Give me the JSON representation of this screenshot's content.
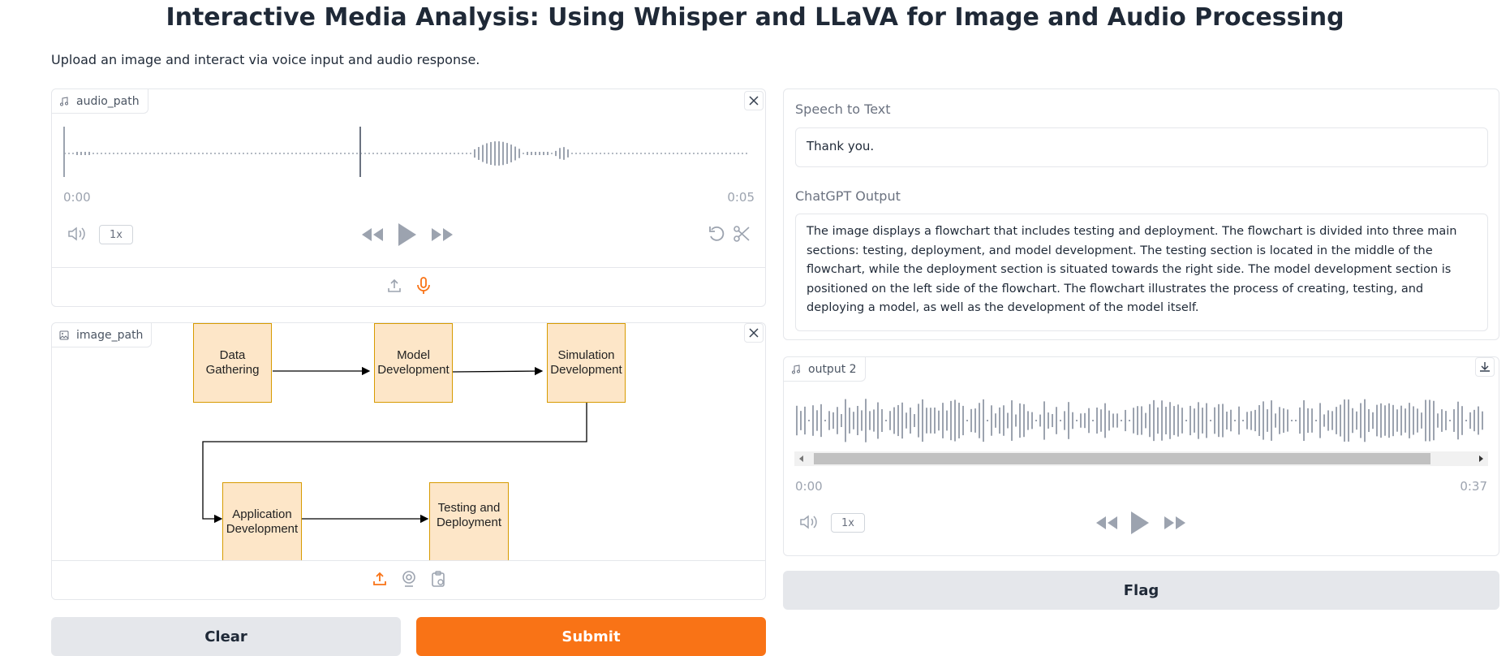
{
  "page": {
    "title": "Interactive Media Analysis: Using Whisper and LLaVA for Image and Audio Processing",
    "description": "Upload an image and interact via voice input and audio response."
  },
  "audio_input": {
    "label": "audio_path",
    "time_start": "0:00",
    "time_end": "0:05",
    "playback_rate": "1x"
  },
  "image_input": {
    "label": "image_path",
    "flowchart": {
      "boxes": [
        {
          "line1": "Data",
          "line2": "Gathering"
        },
        {
          "line1": "Model",
          "line2": "Development"
        },
        {
          "line1": "Simulation",
          "line2": "Development"
        },
        {
          "line1": "Application",
          "line2": "Development"
        },
        {
          "line1": "Testing and",
          "line2": "Deployment"
        }
      ]
    }
  },
  "speech_to_text": {
    "label": "Speech to Text",
    "value": "Thank you."
  },
  "chatgpt_output": {
    "label": "ChatGPT Output",
    "value": "The image displays a flowchart that includes testing and deployment. The flowchart is divided into three main sections: testing, deployment, and model development. The testing section is located in the middle of the flowchart, while the deployment section is situated towards the right side. The model development section is positioned on the left side of the flowchart. The flowchart illustrates the process of creating, testing, and deploying a model, as well as the development of the model itself."
  },
  "audio_output": {
    "label": "output 2",
    "time_start": "0:00",
    "time_end": "0:37",
    "playback_rate": "1x"
  },
  "buttons": {
    "flag": "Flag",
    "clear": "Clear",
    "submit": "Submit"
  },
  "colors": {
    "accent": "#f97316",
    "flowchart_fill": "#fde6c8",
    "flowchart_stroke": "#d79b00",
    "waveform": "#9ca3af"
  }
}
